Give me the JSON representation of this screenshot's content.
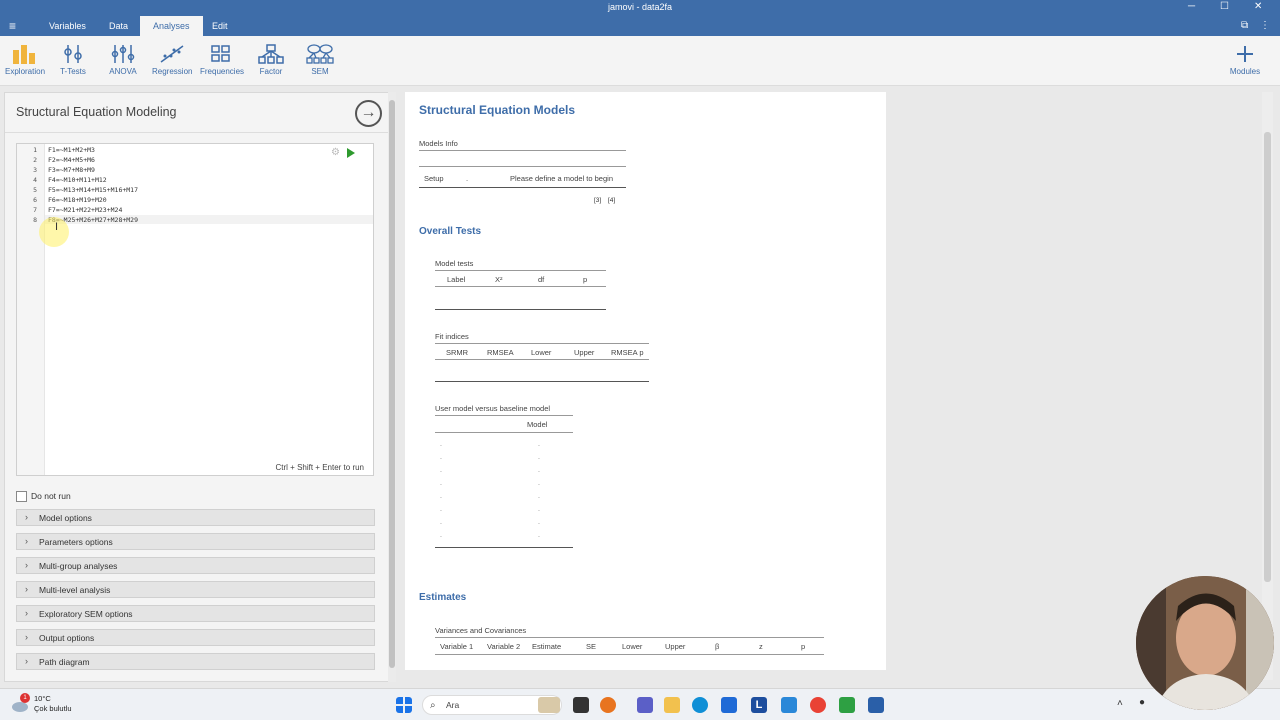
{
  "window": {
    "title": "jamovi - data2fa"
  },
  "menu": {
    "tabs": [
      "Variables",
      "Data",
      "Analyses",
      "Edit"
    ],
    "active": "Analyses"
  },
  "ribbon": {
    "items": [
      {
        "label": "Exploration",
        "icon": "exploration-icon"
      },
      {
        "label": "T-Tests",
        "icon": "t-tests-icon"
      },
      {
        "label": "ANOVA",
        "icon": "anova-icon"
      },
      {
        "label": "Regression",
        "icon": "regression-icon"
      },
      {
        "label": "Frequencies",
        "icon": "frequencies-icon"
      },
      {
        "label": "Factor",
        "icon": "factor-icon"
      },
      {
        "label": "SEM",
        "icon": "sem-icon"
      }
    ],
    "modules_label": "Modules"
  },
  "left_panel": {
    "title": "Structural Equation Modeling",
    "code_lines": [
      {
        "n": "1",
        "text": "F1=~M1+M2+M3"
      },
      {
        "n": "2",
        "text": "F2=~M4+M5+M6"
      },
      {
        "n": "3",
        "text": "F3=~M7+M8+M9"
      },
      {
        "n": "4",
        "text": "F4=~M10+M11+M12"
      },
      {
        "n": "5",
        "text": "F5=~M13+M14+M15+M16+M17"
      },
      {
        "n": "6",
        "text": "F6=~M18+M19+M20"
      },
      {
        "n": "7",
        "text": "F7=~M21+M22+M23+M24"
      },
      {
        "n": "8",
        "text": "F8=~M25+M26+M27+M28+M29"
      }
    ],
    "run_hint": "Ctrl + Shift + Enter to run",
    "do_not_run": "Do not run",
    "options": [
      "Model options",
      "Parameters options",
      "Multi-group analyses",
      "Multi-level analysis",
      "Exploratory SEM options",
      "Output options",
      "Path diagram"
    ]
  },
  "results": {
    "title": "Structural Equation Models",
    "models_info": {
      "caption": "Models Info",
      "setup_label": "Setup",
      "setup_dot": ".",
      "message": "Please define a model to begin",
      "notes": [
        "[3]",
        "[4]"
      ]
    },
    "overall_tests": {
      "heading": "Overall Tests",
      "model_tests": {
        "caption": "Model tests",
        "columns": [
          "Label",
          "X²",
          "df",
          "p"
        ]
      },
      "fit_indices": {
        "caption": "Fit indices",
        "columns": [
          "SRMR",
          "RMSEA",
          "Lower",
          "Upper",
          "RMSEA p"
        ]
      },
      "baseline": {
        "caption": "User model versus baseline model",
        "column": "Model",
        "rows": 8
      }
    },
    "estimates": {
      "heading": "Estimates",
      "var_cov": {
        "caption": "Variances and Covariances",
        "columns": [
          "Variable 1",
          "Variable 2",
          "Estimate",
          "SE",
          "Lower",
          "Upper",
          "β",
          "z",
          "p"
        ]
      }
    }
  },
  "taskbar": {
    "temperature": "10°C",
    "weather": "Çok bulutlu",
    "search": "Ara",
    "weather_badge": "1",
    "app_letter": "L"
  }
}
